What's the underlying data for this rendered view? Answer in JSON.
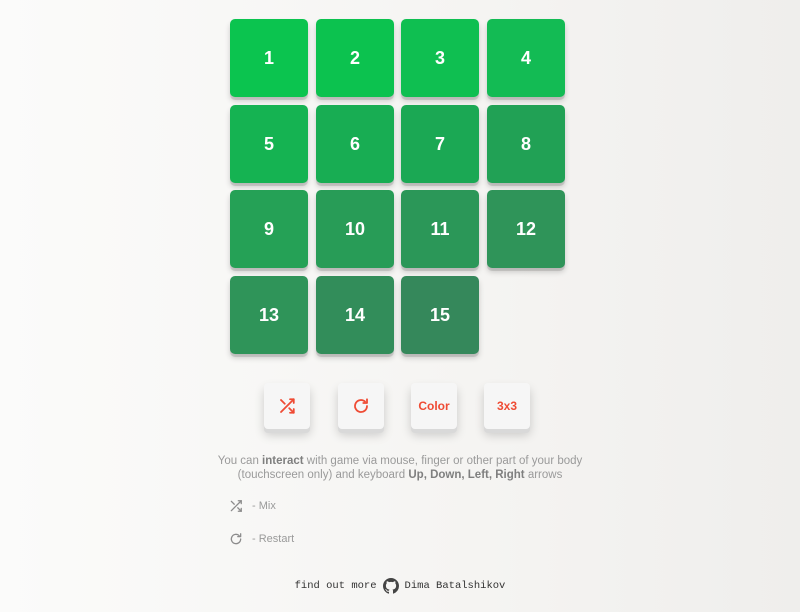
{
  "board": {
    "tiles": [
      {
        "label": "1",
        "color": "#0bc44f"
      },
      {
        "label": "2",
        "color": "#0cc24f"
      },
      {
        "label": "3",
        "color": "#0fbf51"
      },
      {
        "label": "4",
        "color": "#13bb54"
      },
      {
        "label": "5",
        "color": "#15b352"
      },
      {
        "label": "6",
        "color": "#18ad53"
      },
      {
        "label": "7",
        "color": "#1ba854"
      },
      {
        "label": "8",
        "color": "#21a155"
      },
      {
        "label": "9",
        "color": "#25a156"
      },
      {
        "label": "10",
        "color": "#289c57"
      },
      {
        "label": "11",
        "color": "#2b9758"
      },
      {
        "label": "12",
        "color": "#2f9459"
      },
      {
        "label": "13",
        "color": "#2f9459"
      },
      {
        "label": "14",
        "color": "#328d5a"
      },
      {
        "label": "15",
        "color": "#35885b"
      }
    ],
    "empty_cell": "16"
  },
  "controls": {
    "mix_icon": "shuffle-icon",
    "restart_icon": "restart-icon",
    "color_label": "Color",
    "size_label": "3x3",
    "accent_color": "#ef4b34"
  },
  "info": {
    "text_1": "You can ",
    "text_bold_1": "interact",
    "text_2": " with game via mouse, finger or other part of your body (touchscreen only) and keyboard ",
    "text_bold_2": "Up, Down, Left, Right",
    "text_3": " arrows"
  },
  "legend": {
    "mix_label": "- Mix",
    "restart_label": "- Restart"
  },
  "footer": {
    "prefix": "find out more",
    "author": "Dima Batalshikov",
    "icon": "github-icon"
  }
}
